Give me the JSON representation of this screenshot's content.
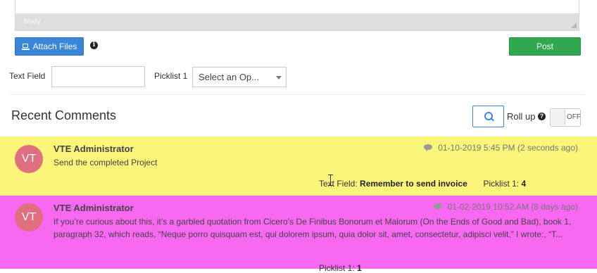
{
  "editor": {
    "path_label": "body"
  },
  "toolbar": {
    "attach_label": "Attach Files",
    "post_label": "Post"
  },
  "fields": {
    "text_field_label": "Text Field",
    "text_field_value": "",
    "picklist_label": "Picklist 1",
    "picklist_placeholder": "Select an Op..."
  },
  "comments_section": {
    "title": "Recent Comments",
    "rollup_label": "Roll up",
    "toggle_state": "OFF"
  },
  "comments": [
    {
      "avatar": "VT",
      "author": "VTE Administrator",
      "timestamp": "01-10-2019 5:45 PM (2 seconds ago)",
      "body": "Send the completed Project",
      "text_field_label": "Text Field:",
      "text_field_value": "Remember to send invoice",
      "picklist_label": "Picklist 1:",
      "picklist_value": "4",
      "background": "#fbf57a"
    },
    {
      "avatar": "VT",
      "author": "VTE Administrator",
      "timestamp": "01-02-2019 10:52 AM (8 days ago)",
      "body": "If you’re curious about this, it’s a garbled quotation from Cicero’s De Finibus Bonorum et Malorum (On the Ends of Good and Bad), book 1, paragraph 32, which reads, “Neque porro quisquam est, qui dolorem ipsum, quia dolor sit, amet, consectetur, adipisci velit,” I wrote:, “T...",
      "picklist_label": "Picklist 1:",
      "picklist_value": "1",
      "background": "#f868f0"
    }
  ],
  "colors": {
    "primary_blue": "#3a86d9",
    "post_green": "#2fa84f",
    "avatar_pink": "#e06f80",
    "yellow_highlight": "#fbf57a",
    "magenta_highlight": "#f868f0"
  },
  "icons": [
    "laptop-icon",
    "info-icon",
    "search-icon",
    "help-icon",
    "comment-bubble-icon",
    "resize-grip-icon"
  ]
}
